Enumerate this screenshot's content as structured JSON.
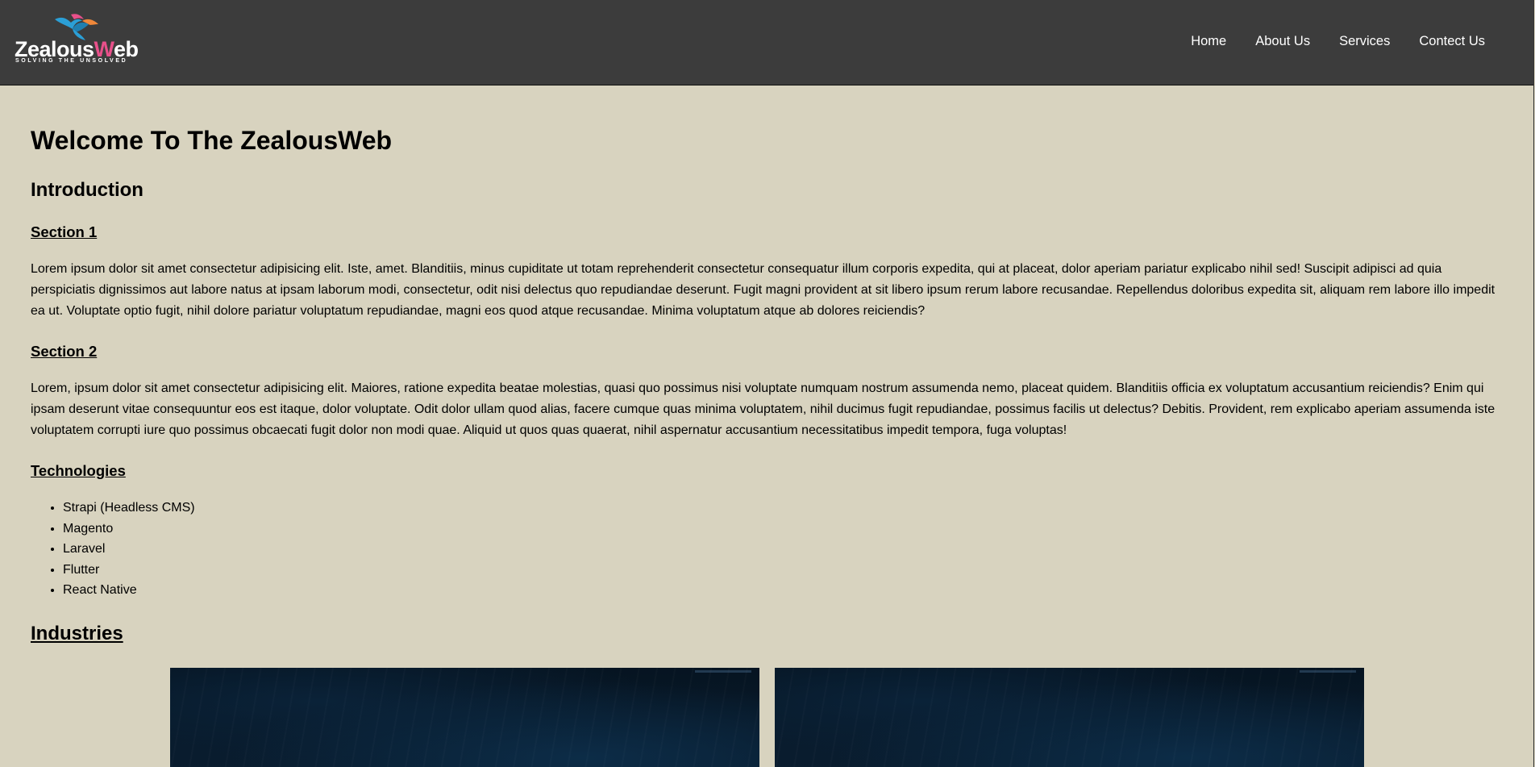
{
  "header": {
    "logo": {
      "word_main": "Zealous",
      "word_accent_letter": "W",
      "word_end": "eb",
      "tagline": "SOLVING THE UNSOLVED",
      "colors": {
        "bird_blue": "#2b9fd6",
        "bird_teal": "#1f7fb0",
        "bird_orange": "#f0883a",
        "bird_pink": "#e8508a"
      }
    },
    "nav": [
      {
        "label": "Home"
      },
      {
        "label": "About Us"
      },
      {
        "label": "Services"
      },
      {
        "label": "Contect Us"
      }
    ]
  },
  "main": {
    "title": "Welcome To The ZealousWeb",
    "intro_heading": "Introduction",
    "section1": {
      "heading": "Section 1",
      "text": "Lorem ipsum dolor sit amet consectetur adipisicing elit. Iste, amet. Blanditiis, minus cupiditate ut totam reprehenderit consectetur consequatur illum corporis expedita, qui at placeat, dolor aperiam pariatur explicabo nihil sed! Suscipit adipisci ad quia perspiciatis dignissimos aut labore natus at ipsam laborum modi, consectetur, odit nisi delectus quo repudiandae deserunt. Fugit magni provident at sit libero ipsum rerum labore recusandae. Repellendus doloribus expedita sit, aliquam rem labore illo impedit ea ut. Voluptate optio fugit, nihil dolore pariatur voluptatum repudiandae, magni eos quod atque recusandae. Minima voluptatum atque ab dolores reiciendis?"
    },
    "section2": {
      "heading": "Section 2",
      "text": "Lorem, ipsum dolor sit amet consectetur adipisicing elit. Maiores, ratione expedita beatae molestias, quasi quo possimus nisi voluptate numquam nostrum assumenda nemo, placeat quidem. Blanditiis officia ex voluptatum accusantium reiciendis? Enim qui ipsam deserunt vitae consequuntur eos est itaque, dolor voluptate. Odit dolor ullam quod alias, facere cumque quas minima voluptatem, nihil ducimus fugit repudiandae, possimus facilis ut delectus? Debitis. Provident, rem explicabo aperiam assumenda iste voluptatem corrupti iure quo possimus obcaecati fugit dolor non modi quae. Aliquid ut quos quas quaerat, nihil aspernatur accusantium necessitatibus impedit tempora, fuga voluptas!"
    },
    "technologies": {
      "heading": "Technologies",
      "items": [
        "Strapi (Headless CMS)",
        "Magento",
        "Laravel",
        "Flutter",
        "React Native"
      ]
    },
    "industries": {
      "heading": "Industries"
    }
  }
}
